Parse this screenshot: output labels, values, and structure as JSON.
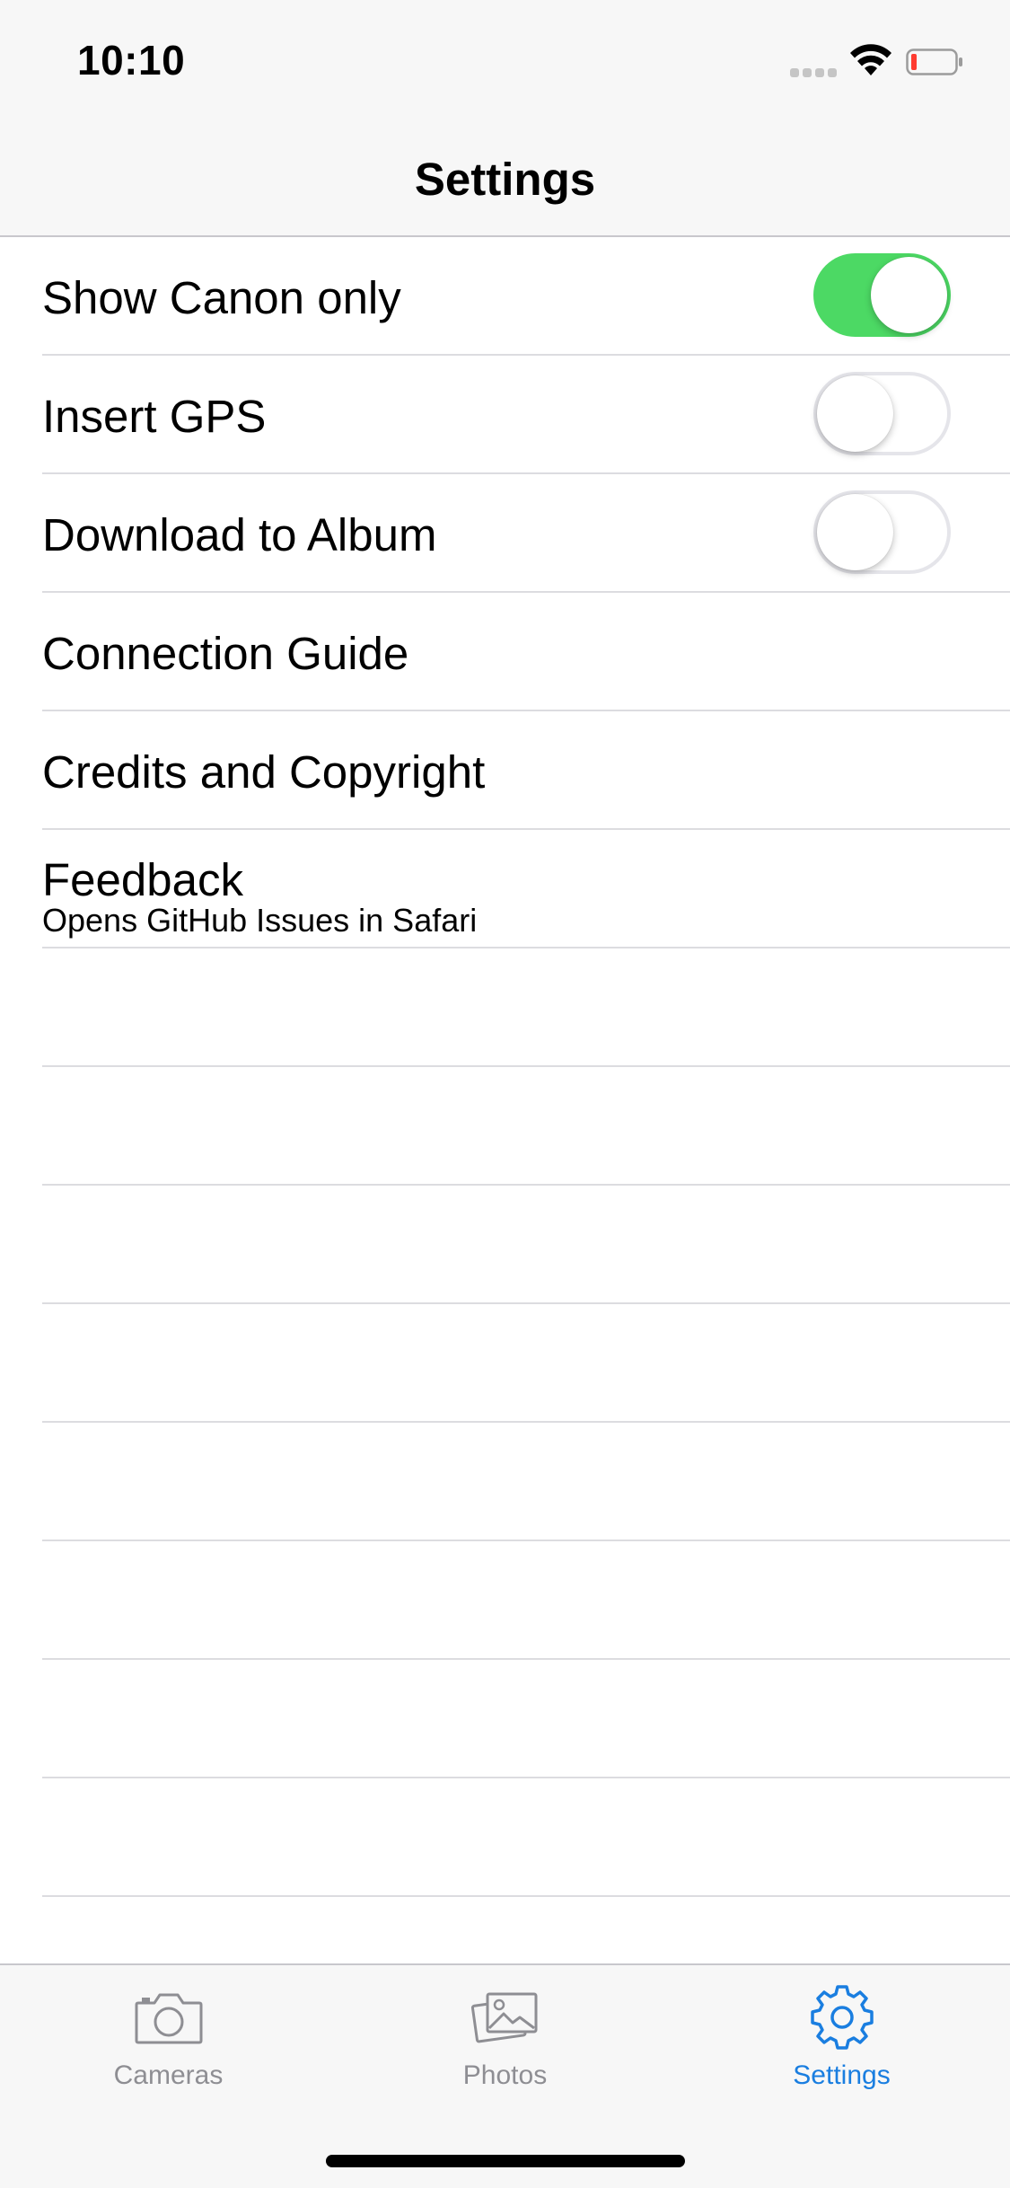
{
  "status_bar": {
    "time": "10:10"
  },
  "nav": {
    "title": "Settings"
  },
  "settings": {
    "rows": [
      {
        "label": "Show Canon only",
        "toggle": true
      },
      {
        "label": "Insert GPS",
        "toggle": false
      },
      {
        "label": "Download to Album",
        "toggle": false
      },
      {
        "label": "Connection Guide"
      },
      {
        "label": "Credits and Copyright"
      },
      {
        "label": "Feedback",
        "subtitle": "Opens GitHub Issues in Safari"
      }
    ]
  },
  "tab_bar": {
    "tabs": [
      {
        "label": "Cameras",
        "icon": "camera-icon",
        "active": false
      },
      {
        "label": "Photos",
        "icon": "photos-icon",
        "active": false
      },
      {
        "label": "Settings",
        "icon": "gear-icon",
        "active": true
      }
    ]
  },
  "colors": {
    "toggle_on": "#4cd964",
    "tab_active": "#1a7ee0",
    "tab_inactive": "#8e8e93",
    "battery_low": "#ff3b30"
  }
}
